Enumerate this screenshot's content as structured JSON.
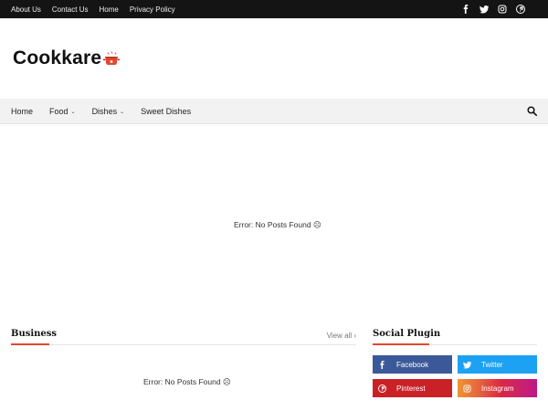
{
  "topbar": {
    "links": [
      "About Us",
      "Contact Us",
      "Home",
      "Privacy Policy"
    ],
    "social_icons": [
      "facebook-icon",
      "twitter-icon",
      "instagram-icon",
      "pinterest-icon"
    ]
  },
  "header": {
    "logo_text": "Cookkare",
    "logo_icon": "cooking-pot-icon"
  },
  "nav": {
    "items": [
      {
        "label": "Home",
        "has_dropdown": false
      },
      {
        "label": "Food",
        "has_dropdown": true
      },
      {
        "label": "Dishes",
        "has_dropdown": true
      },
      {
        "label": "Sweet Dishes",
        "has_dropdown": false
      }
    ],
    "search_icon": "search-icon"
  },
  "hero": {
    "error_text": "Error: No Posts Found ☹"
  },
  "business": {
    "title": "Business",
    "view_all": "View all ›",
    "error_text": "Error: No Posts Found ☹"
  },
  "social_plugin": {
    "title": "Social Plugin",
    "buttons": [
      {
        "label": "Facebook",
        "color": "#3b5998",
        "icon": "facebook-icon"
      },
      {
        "label": "Twitter",
        "color": "#1da1f2",
        "icon": "twitter-icon"
      },
      {
        "label": "Pinterest",
        "color": "#ca2127",
        "icon": "pinterest-icon"
      },
      {
        "label": "Instagram",
        "color": "#e1306c",
        "icon": "instagram-icon"
      }
    ]
  },
  "colors": {
    "topbar_bg": "#141414",
    "accent": "#e2472f",
    "nav_bg": "#f2f2f2"
  }
}
